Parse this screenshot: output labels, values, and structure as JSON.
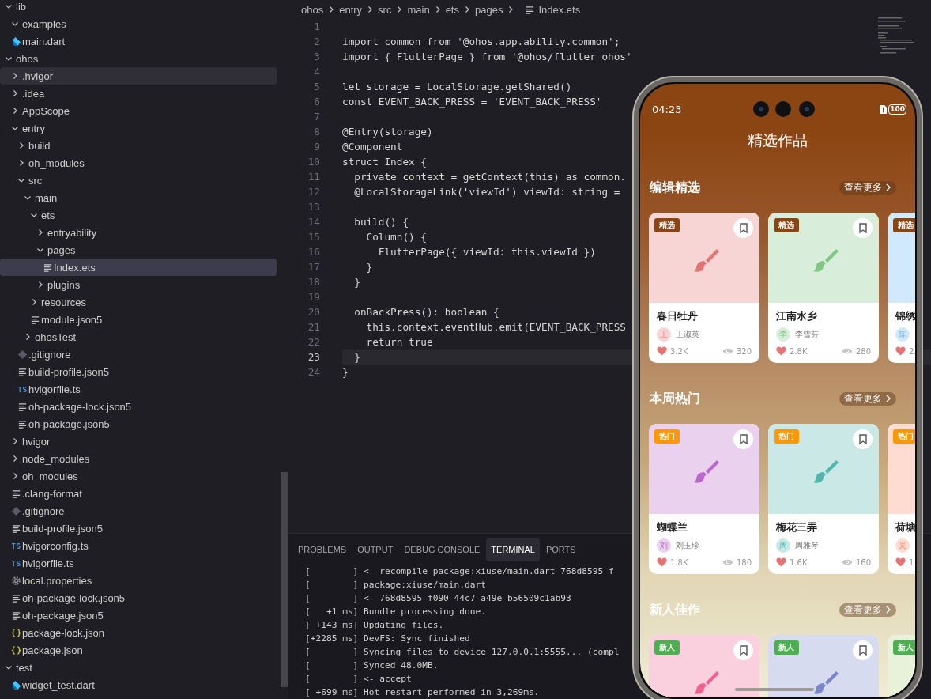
{
  "explorer": {
    "tree": [
      {
        "name": "lib",
        "kind": "folder",
        "expanded": true,
        "selected": false,
        "hovered": false,
        "children": [
          {
            "name": "examples",
            "kind": "folder",
            "expanded": true,
            "selected": false,
            "hovered": false
          },
          {
            "name": "main.dart",
            "kind": "dart",
            "selected": false,
            "hovered": false
          }
        ]
      },
      {
        "name": "ohos",
        "kind": "folder",
        "expanded": true,
        "selected": false,
        "hovered": false,
        "children": [
          {
            "name": ".hvigor",
            "kind": "folder",
            "expanded": false,
            "selected": false,
            "hovered": true
          },
          {
            "name": ".idea",
            "kind": "folder",
            "expanded": false,
            "selected": false,
            "hovered": false
          },
          {
            "name": "AppScope",
            "kind": "folder",
            "expanded": false,
            "selected": false,
            "hovered": false
          },
          {
            "name": "entry",
            "kind": "folder",
            "expanded": true,
            "selected": false,
            "hovered": false,
            "children": [
              {
                "name": "build",
                "kind": "folder",
                "expanded": false,
                "selected": false,
                "hovered": false
              },
              {
                "name": "oh_modules",
                "kind": "folder",
                "expanded": false,
                "selected": false,
                "hovered": false
              },
              {
                "name": "src",
                "kind": "folder",
                "expanded": true,
                "selected": false,
                "hovered": false,
                "children": [
                  {
                    "name": "main",
                    "kind": "folder",
                    "expanded": true,
                    "selected": false,
                    "hovered": false,
                    "children": [
                      {
                        "name": "ets",
                        "kind": "folder",
                        "expanded": true,
                        "selected": false,
                        "hovered": false,
                        "children": [
                          {
                            "name": "entryability",
                            "kind": "folder",
                            "expanded": false,
                            "selected": false,
                            "hovered": false
                          },
                          {
                            "name": "pages",
                            "kind": "folder",
                            "expanded": true,
                            "selected": false,
                            "hovered": false,
                            "children": [
                              {
                                "name": "Index.ets",
                                "kind": "lines",
                                "selected": true,
                                "hovered": false
                              }
                            ]
                          },
                          {
                            "name": "plugins",
                            "kind": "folder",
                            "expanded": false,
                            "selected": false,
                            "hovered": false
                          }
                        ]
                      },
                      {
                        "name": "resources",
                        "kind": "folder",
                        "expanded": false,
                        "selected": false,
                        "hovered": false
                      },
                      {
                        "name": "module.json5",
                        "kind": "lines",
                        "selected": false,
                        "hovered": false
                      }
                    ]
                  },
                  {
                    "name": "ohosTest",
                    "kind": "folder",
                    "expanded": false,
                    "selected": false,
                    "hovered": false
                  }
                ]
              },
              {
                "name": ".gitignore",
                "kind": "git",
                "selected": false,
                "hovered": false
              },
              {
                "name": "build-profile.json5",
                "kind": "lines",
                "selected": false,
                "hovered": false
              },
              {
                "name": "hvigorfile.ts",
                "kind": "ts",
                "selected": false,
                "hovered": false
              },
              {
                "name": "oh-package-lock.json5",
                "kind": "lines",
                "selected": false,
                "hovered": false
              },
              {
                "name": "oh-package.json5",
                "kind": "lines",
                "selected": false,
                "hovered": false
              }
            ]
          },
          {
            "name": "hvigor",
            "kind": "folder",
            "expanded": false,
            "selected": false,
            "hovered": false
          },
          {
            "name": "node_modules",
            "kind": "folder",
            "expanded": false,
            "selected": false,
            "hovered": false
          },
          {
            "name": "oh_modules",
            "kind": "folder",
            "expanded": false,
            "selected": false,
            "hovered": false
          },
          {
            "name": ".clang-format",
            "kind": "lines",
            "selected": false,
            "hovered": false
          },
          {
            "name": ".gitignore",
            "kind": "git",
            "selected": false,
            "hovered": false
          },
          {
            "name": "build-profile.json5",
            "kind": "lines",
            "selected": false,
            "hovered": false
          },
          {
            "name": "hvigorconfig.ts",
            "kind": "ts",
            "selected": false,
            "hovered": false
          },
          {
            "name": "hvigorfile.ts",
            "kind": "ts",
            "selected": false,
            "hovered": false
          },
          {
            "name": "local.properties",
            "kind": "gear",
            "selected": false,
            "hovered": false
          },
          {
            "name": "oh-package-lock.json5",
            "kind": "lines",
            "selected": false,
            "hovered": false
          },
          {
            "name": "oh-package.json5",
            "kind": "lines",
            "selected": false,
            "hovered": false
          },
          {
            "name": "package-lock.json",
            "kind": "braces",
            "selected": false,
            "hovered": false
          },
          {
            "name": "package.json",
            "kind": "braces",
            "selected": false,
            "hovered": false
          }
        ]
      },
      {
        "name": "test",
        "kind": "folder",
        "expanded": true,
        "selected": false,
        "hovered": false,
        "children": [
          {
            "name": "widget_test.dart",
            "kind": "dart",
            "selected": false,
            "hovered": false
          }
        ]
      }
    ]
  },
  "editor": {
    "breadcrumb": [
      "ohos",
      "entry",
      "src",
      "main",
      "ets",
      "pages",
      "Index.ets"
    ],
    "lines": [
      {
        "number": "1",
        "current": false
      },
      {
        "number": "2",
        "code": "import common from '@ohos.app.ability.common';",
        "current": false
      },
      {
        "number": "3",
        "code": "import { FlutterPage } from '@ohos/flutter_ohos'",
        "current": false
      },
      {
        "number": "4",
        "current": false
      },
      {
        "number": "5",
        "code": "let storage = LocalStorage.getShared()",
        "current": false
      },
      {
        "number": "6",
        "code": "const EVENT_BACK_PRESS = 'EVENT_BACK_PRESS'",
        "current": false
      },
      {
        "number": "7",
        "current": false
      },
      {
        "number": "8",
        "code": "@Entry(storage)",
        "current": false
      },
      {
        "number": "9",
        "code": "@Component",
        "current": false
      },
      {
        "number": "10",
        "code": "struct Index {",
        "current": false
      },
      {
        "number": "11",
        "code": "  private context = getContext(this) as common.",
        "current": false
      },
      {
        "number": "12",
        "code": "  @LocalStorageLink('viewId') viewId: string =",
        "current": false
      },
      {
        "number": "13",
        "current": false
      },
      {
        "number": "14",
        "code": "  build() {",
        "current": false
      },
      {
        "number": "15",
        "code": "    Column() {",
        "current": false
      },
      {
        "number": "16",
        "code": "      FlutterPage({ viewId: this.viewId })",
        "current": false
      },
      {
        "number": "17",
        "code": "    }",
        "current": false
      },
      {
        "number": "18",
        "code": "  }",
        "current": false
      },
      {
        "number": "19",
        "current": false
      },
      {
        "number": "20",
        "code": "  onBackPress(): boolean {",
        "current": false
      },
      {
        "number": "21",
        "code": "    this.context.eventHub.emit(EVENT_BACK_PRESS",
        "current": false
      },
      {
        "number": "22",
        "code": "    return true",
        "current": false
      },
      {
        "number": "23",
        "code": "  }",
        "current": true
      },
      {
        "number": "24",
        "code": "}",
        "current": false
      }
    ]
  },
  "panel": {
    "tabs": [
      {
        "label": "PROBLEMS",
        "selected": false
      },
      {
        "label": "OUTPUT",
        "selected": false
      },
      {
        "label": "DEBUG CONSOLE",
        "selected": false
      },
      {
        "label": "TERMINAL",
        "selected": true
      },
      {
        "label": "PORTS",
        "selected": false
      }
    ],
    "terminal_lines": [
      "[        ] <- recompile package:xiuse/main.dart 768d8595-f",
      "[        ] package:xiuse/main.dart",
      "[        ] <- 768d8595-f090-44c7-a49e-b56509c1ab93",
      "[   +1 ms] Bundle processing done.",
      "[ +143 ms] Updating files.",
      "[+2285 ms] DevFS: Sync finished",
      "[        ] Syncing files to device 127.0.0.1:5555... (compl",
      "[        ] Synced 48.0MB.",
      "[        ] <- accept",
      "[ +699 ms] Hot restart performed in 3,269ms."
    ]
  },
  "phone": {
    "status_bar": {
      "time": "04:23",
      "battery": "100"
    },
    "title": "精选作品",
    "sections": [
      {
        "title": "编辑精选",
        "more": "查看更多",
        "color": "#8b4513",
        "cards": [
          {
            "badge": "精选",
            "title": "春日牡丹",
            "avatar": "王",
            "author": "王淑英",
            "likes": "3.2K",
            "views": "320",
            "color": "#f7d5d5"
          },
          {
            "badge": "精选",
            "title": "江南水乡",
            "avatar": "李",
            "author": "李雪芬",
            "likes": "2.8K",
            "views": "280",
            "color": "#d9eeda"
          },
          {
            "badge": "精选",
            "title": "锦绣",
            "avatar": "陈",
            "likes": "2.",
            "color": "#d1e9fc"
          }
        ]
      },
      {
        "title": "本周热门",
        "more": "查看更多",
        "color": "#ff9800",
        "cards": [
          {
            "badge": "热门",
            "title": "蝴蝶兰",
            "avatar": "刘",
            "author": "刘玉珍",
            "likes": "1.8K",
            "views": "180",
            "color": "#ead2ef"
          },
          {
            "badge": "热门",
            "title": "梅花三弄",
            "avatar": "周",
            "author": "周雅琴",
            "likes": "1.6K",
            "views": "160",
            "color": "#cae9e6"
          },
          {
            "badge": "热门",
            "title": "荷塘",
            "avatar": "吴",
            "likes": "1.",
            "color": "#ffdcd1"
          }
        ]
      },
      {
        "title": "新人佳作",
        "more": "查看更多",
        "color": "#4caf50",
        "cards": [
          {
            "badge": "新人",
            "color": "#fbd0de"
          },
          {
            "badge": "新人",
            "color": "#d7dbef"
          },
          {
            "badge": "新人",
            "color": "#e7f2d9"
          }
        ]
      }
    ]
  }
}
